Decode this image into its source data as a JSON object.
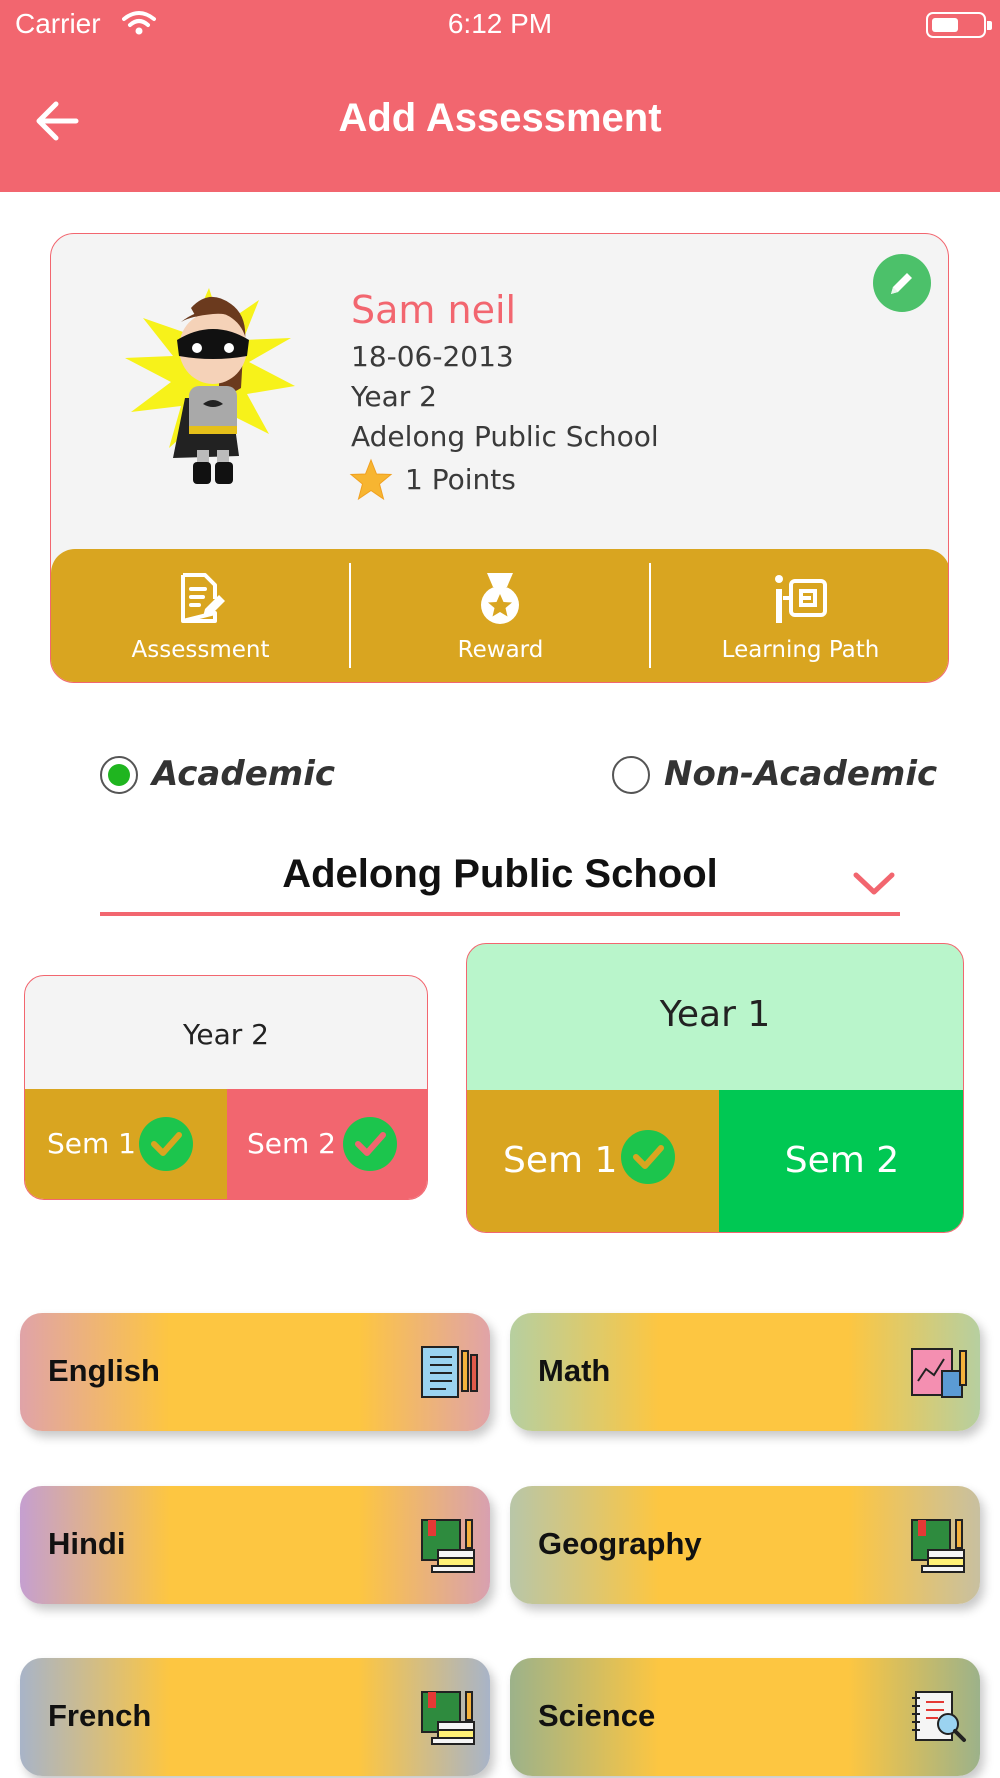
{
  "status_bar": {
    "carrier": "Carrier",
    "time": "6:12 PM"
  },
  "header": {
    "title": "Add Assessment"
  },
  "profile": {
    "name": "Sam neil",
    "dob": "18-06-2013",
    "year": "Year 2",
    "school": "Adelong Public School",
    "points": "1 Points"
  },
  "actions": [
    {
      "label": "Assessment",
      "icon": "document-edit-icon"
    },
    {
      "label": "Reward",
      "icon": "medal-icon"
    },
    {
      "label": "Learning Path",
      "icon": "learning-path-icon"
    }
  ],
  "assessment_type": {
    "options": [
      "Academic",
      "Non-Academic"
    ],
    "selected": "Academic"
  },
  "school_dropdown": {
    "value": "Adelong Public School"
  },
  "years": [
    {
      "title": "Year 2",
      "semesters": [
        {
          "label": "Sem 1",
          "completed": true
        },
        {
          "label": "Sem 2",
          "completed": true
        }
      ]
    },
    {
      "title": "Year 1",
      "selected": true,
      "semesters": [
        {
          "label": "Sem 1",
          "completed": true
        },
        {
          "label": "Sem 2",
          "completed": false
        }
      ]
    }
  ],
  "subjects": [
    {
      "label": "English",
      "icon": "notebook-pencil-icon"
    },
    {
      "label": "Math",
      "icon": "chart-book-icon"
    },
    {
      "label": "Hindi",
      "icon": "books-icon"
    },
    {
      "label": "Geography",
      "icon": "books-icon"
    },
    {
      "label": "French",
      "icon": "books-icon"
    },
    {
      "label": "Science",
      "icon": "notebook-magnifier-icon"
    }
  ],
  "colors": {
    "primary": "#f2666f",
    "gold": "#d9a520",
    "green": "#00c853",
    "mint": "#b9f5cb",
    "tile_yellow": "#fdc641"
  }
}
